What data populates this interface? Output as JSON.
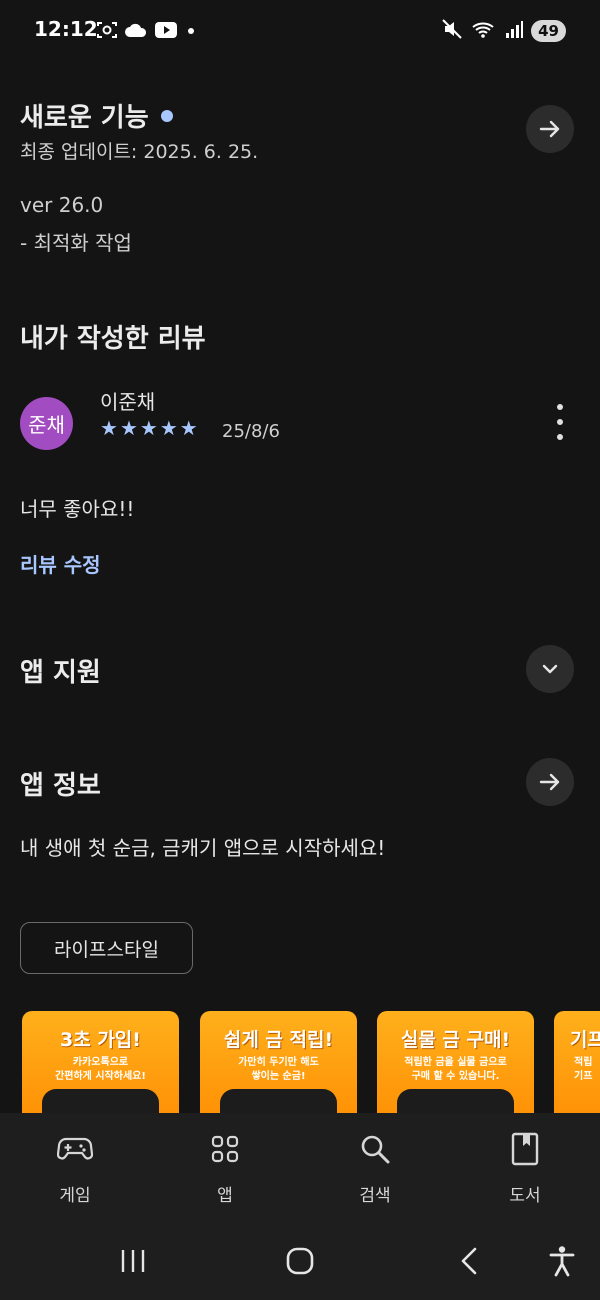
{
  "status_bar": {
    "time": "12:12",
    "battery": "49",
    "left_icons": [
      "screenshot-icon",
      "cloud-icon",
      "youtube-icon",
      "dot-icon"
    ],
    "right_icons": [
      "mute-icon",
      "wifi-5g-icon",
      "signal-icon"
    ]
  },
  "whats_new": {
    "title": "새로운 기능",
    "updated": "최종 업데이트: 2025. 6. 25.",
    "version": "ver 26.0",
    "note": "- 최적화 작업"
  },
  "my_review": {
    "title": "내가 작성한 리뷰",
    "avatar_text": "준채",
    "reviewer": "이준채",
    "rating": 5,
    "date": "25/8/6",
    "text": "너무 좋아요!!",
    "edit_label": "리뷰 수정"
  },
  "app_support": {
    "title": "앱 지원"
  },
  "app_info": {
    "title": "앱 정보",
    "description": "내 생애 첫 순금, 금캐기 앱으로 시작하세요!",
    "category": "라이프스타일"
  },
  "screenshots": [
    {
      "title": "3초 가입!",
      "line1": "카카오톡으로",
      "line2": "간편하게 시작하세요!"
    },
    {
      "title": "쉽게 금 적립!",
      "line1": "가만히 두기만 해도",
      "line2": "쌓이는 순금!"
    },
    {
      "title": "실물 금 구매!",
      "line1": "적립한 금을 실물 금으로",
      "line2": "구매 할 수 있습니다."
    },
    {
      "title": "기프",
      "line1": "적립",
      "line2": "기프"
    }
  ],
  "bottom_nav": [
    {
      "label": "게임",
      "icon": "gamepad-icon"
    },
    {
      "label": "앱",
      "icon": "apps-grid-icon"
    },
    {
      "label": "검색",
      "icon": "search-icon"
    },
    {
      "label": "도서",
      "icon": "book-icon"
    }
  ],
  "colors": {
    "background": "#141414",
    "accent": "#a9c7ff",
    "avatar": "#a24cc2",
    "screenshot_orange": "#ff9a0a"
  }
}
